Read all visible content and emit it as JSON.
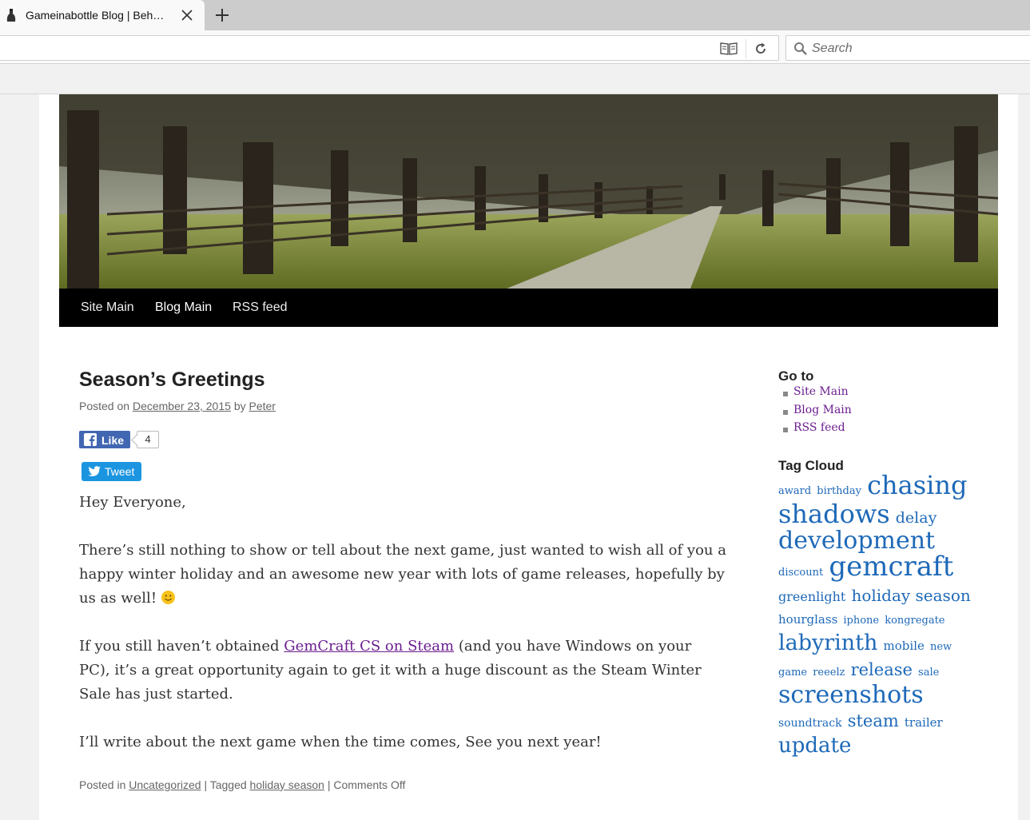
{
  "browser": {
    "tab_title": "Gameinabottle Blog | Beh…",
    "search_placeholder": "Search"
  },
  "site_nav": [
    "Site Main",
    "Blog Main",
    "RSS feed"
  ],
  "post": {
    "title": "Season’s Greetings",
    "posted_on_label": "Posted on",
    "date": "December 23, 2015",
    "by_label": "by",
    "author": "Peter",
    "fb_like_label": "Like",
    "fb_like_count": "4",
    "tweet_label": "Tweet",
    "greeting": "Hey Everyone,",
    "para1": "There’s still nothing to show or tell about the next game, just wanted to wish all of you a happy winter holiday and an awesome new year with lots of game releases, hopefully by us as well!",
    "para2_before": "If you still haven’t obtained",
    "para2_link": "GemCraft CS on Steam",
    "para2_after": "(and you have Windows on your PC), it’s a great opportunity again to get it with a huge discount as the Steam Winter Sale has just started.",
    "para3": "I’ll write about the next game when the time comes, See you next year!",
    "footer": {
      "posted_in_label": "Posted in",
      "category": "Uncategorized",
      "sep1": "|",
      "tagged_label": "Tagged",
      "tag": "holiday season",
      "sep2": "|",
      "comments": "Comments Off"
    }
  },
  "sidebar": {
    "goto_title": "Go to",
    "goto_links": [
      "Site Main",
      "Blog Main",
      "RSS feed"
    ],
    "tagcloud_title": "Tag Cloud",
    "tags": [
      {
        "label": "award",
        "size": 13
      },
      {
        "label": "birthday",
        "size": 13
      },
      {
        "label": "chasing shadows",
        "size": 32
      },
      {
        "label": "delay",
        "size": 19
      },
      {
        "label": "development",
        "size": 30
      },
      {
        "label": "discount",
        "size": 13
      },
      {
        "label": "gemcraft",
        "size": 34
      },
      {
        "label": "greenlight",
        "size": 16
      },
      {
        "label": "holiday season",
        "size": 20
      },
      {
        "label": "hourglass",
        "size": 15
      },
      {
        "label": "iphone",
        "size": 13
      },
      {
        "label": "kongregate",
        "size": 13
      },
      {
        "label": "labyrinth",
        "size": 27
      },
      {
        "label": "mobile",
        "size": 15
      },
      {
        "label": "new game",
        "size": 13
      },
      {
        "label": "reeelz",
        "size": 13
      },
      {
        "label": "release",
        "size": 21
      },
      {
        "label": "sale",
        "size": 13
      },
      {
        "label": "screenshots",
        "size": 30
      },
      {
        "label": "soundtrack",
        "size": 14
      },
      {
        "label": "steam",
        "size": 21
      },
      {
        "label": "trailer",
        "size": 15
      },
      {
        "label": "update",
        "size": 26
      }
    ]
  }
}
